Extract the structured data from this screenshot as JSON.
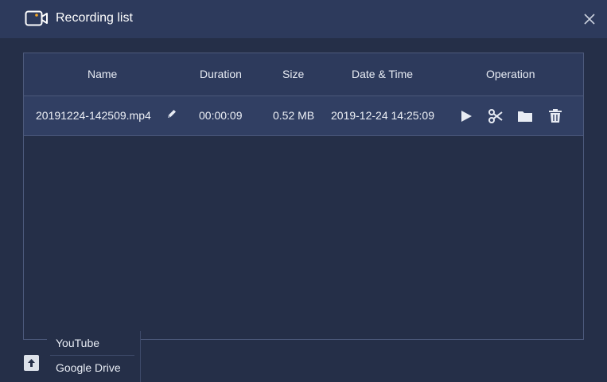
{
  "window": {
    "title": "Recording list",
    "icons": {
      "title": "video-camera-icon",
      "close": "close-icon"
    }
  },
  "table": {
    "headers": {
      "name": "Name",
      "duration": "Duration",
      "size": "Size",
      "datetime": "Date & Time",
      "operation": "Operation"
    },
    "rows": [
      {
        "name": "20191224-142509.mp4",
        "duration": "00:00:09",
        "size": "0.52 MB",
        "datetime": "2019-12-24 14:25:09",
        "operations": [
          "play-icon",
          "scissors-icon",
          "folder-icon",
          "trash-icon"
        ]
      }
    ]
  },
  "upload": {
    "icon": "upload-arrow-icon",
    "menu": [
      "YouTube",
      "Google Drive"
    ]
  },
  "colors": {
    "background": "#252f48",
    "header": "#2d3a5c",
    "row": "#313f63",
    "accent": "#f5a623"
  }
}
